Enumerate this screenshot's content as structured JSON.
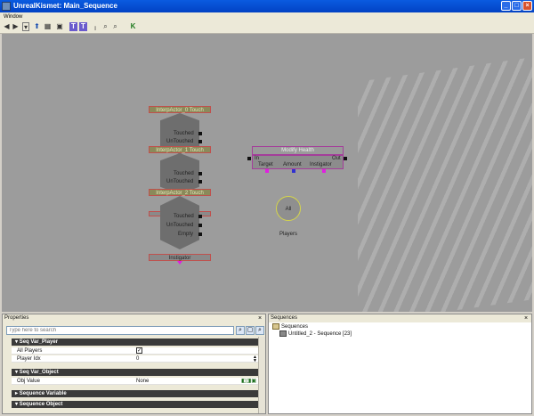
{
  "window": {
    "title": "UnrealKismet: Main_Sequence",
    "minimize": "_",
    "maximize": "□",
    "close": "×"
  },
  "menu": {
    "window_label": "Window"
  },
  "toolbar": {
    "icons": [
      {
        "name": "back-arrow-icon",
        "glyph": "◀"
      },
      {
        "name": "forward-arrow-icon",
        "glyph": "▶"
      },
      {
        "name": "dropdown-icon",
        "glyph": "▾"
      },
      {
        "name": "up-arrow-icon",
        "glyph": "⬆"
      },
      {
        "name": "grid-icon",
        "glyph": "▦"
      },
      {
        "name": "camera-icon",
        "glyph": "▣"
      },
      {
        "name": "text-t-icon",
        "glyph": "T"
      },
      {
        "name": "text-t-alt-icon",
        "glyph": "T"
      },
      {
        "name": "pin-icon",
        "glyph": "╷"
      },
      {
        "name": "search-icon",
        "glyph": "⌕"
      },
      {
        "name": "search-alt-icon",
        "glyph": "⌕"
      },
      {
        "name": "kismet-k-icon",
        "glyph": "K"
      }
    ]
  },
  "canvas": {
    "touch_nodes": [
      {
        "title": "InterpActor_0 Touch",
        "outputs": [
          "Touched",
          "UnTouched"
        ]
      },
      {
        "title": "InterpActor_1 Touch",
        "outputs": [
          "Touched",
          "UnTouched"
        ]
      },
      {
        "title": "InterpActor_2 Touch",
        "outputs": [
          "Touched",
          "UnTouched",
          "Empty"
        ]
      }
    ],
    "instigator_label": "Instigator",
    "modify_health": {
      "title": "Modify Health",
      "in_label": "In",
      "out_label": "Out",
      "vars": [
        "Target",
        "Amount",
        "Instigator"
      ],
      "var_colors": [
        "#e020e0",
        "#3030d0",
        "#e020e0"
      ]
    },
    "all_players": "All Players"
  },
  "properties": {
    "title": "Properties",
    "close": "×",
    "search_placeholder": "Type here to search",
    "categories": [
      {
        "name": "Seq Var_Player",
        "rows": [
          {
            "label": "All Players",
            "checked": true
          },
          {
            "label": "Player Idx",
            "value": "0"
          }
        ]
      },
      {
        "name": "Seq Var_Object",
        "rows": [
          {
            "label": "Obj Value",
            "value": "None"
          }
        ]
      },
      {
        "name": "Sequence Variable"
      },
      {
        "name": "Sequence Object"
      }
    ]
  },
  "sequences": {
    "title": "Sequences",
    "close": "×",
    "root": "Sequences",
    "child": "Untitled_2 - Sequence [23]"
  }
}
